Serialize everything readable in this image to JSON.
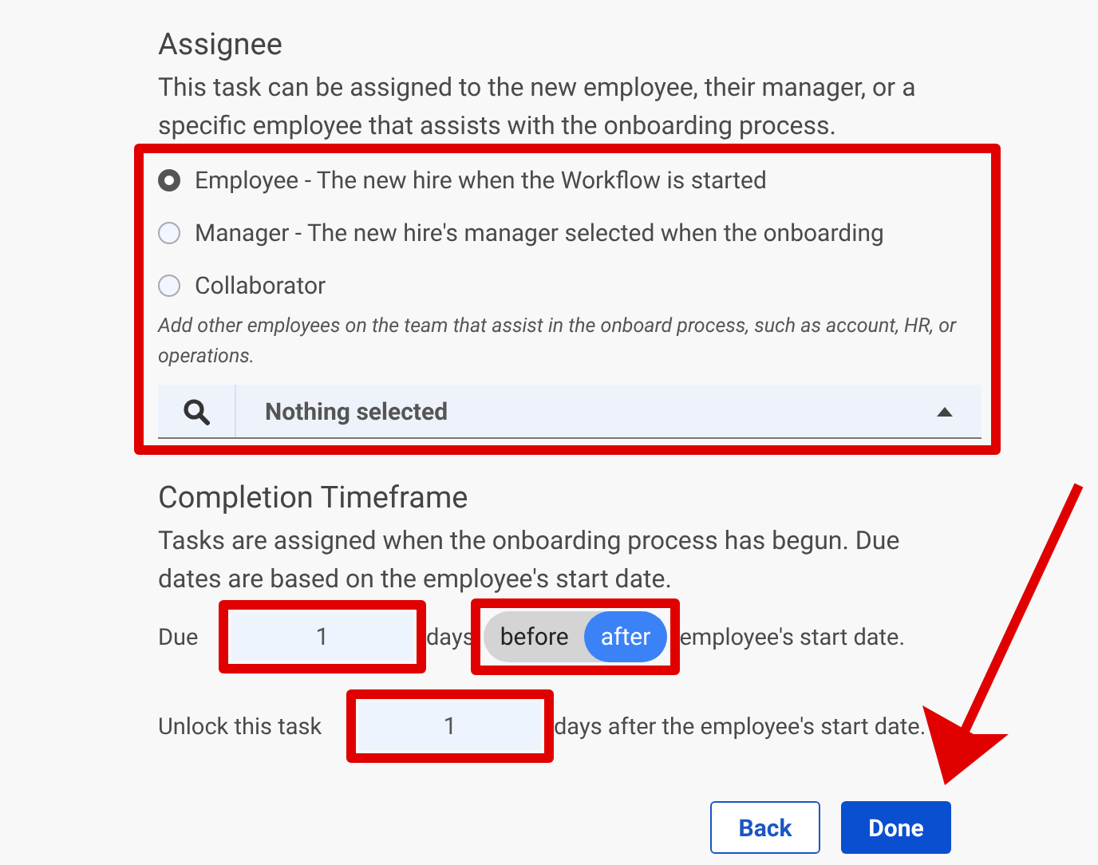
{
  "assignee": {
    "title": "Assignee",
    "description": "This task can be assigned to the new employee, their manager, or a specific employee that assists with the onboarding process.",
    "highlighted": true,
    "options": [
      {
        "label": "Employee - The new hire when the Workflow is started",
        "selected": true
      },
      {
        "label": "Manager - The new hire's manager selected when the onboarding",
        "selected": false
      },
      {
        "label": "Collaborator",
        "selected": false
      }
    ],
    "hint": "Add other employees on the team that assist in the onboard process, such as account, HR, or operations.",
    "collaborator_select": {
      "value": "Nothing selected",
      "expanded": true
    }
  },
  "completion": {
    "title": "Completion Timeframe",
    "description": "Tasks are assigned when the onboarding process has begun. Due dates are based on the employee's start date.",
    "due": {
      "label": "Due",
      "value": "1",
      "highlighted": true,
      "unit": "days",
      "toggle": {
        "highlighted": true,
        "options": [
          {
            "label": "before",
            "selected": false
          },
          {
            "label": "after",
            "selected": true
          }
        ]
      },
      "suffix": "employee's start date."
    },
    "unlock": {
      "label": "Unlock this task",
      "value": "1",
      "highlighted": true,
      "suffix": "days after the employee's start date."
    }
  },
  "buttons": [
    {
      "label": "Back",
      "kind": "secondary"
    },
    {
      "label": "Done",
      "kind": "primary"
    }
  ],
  "pointer_arrow": true
}
